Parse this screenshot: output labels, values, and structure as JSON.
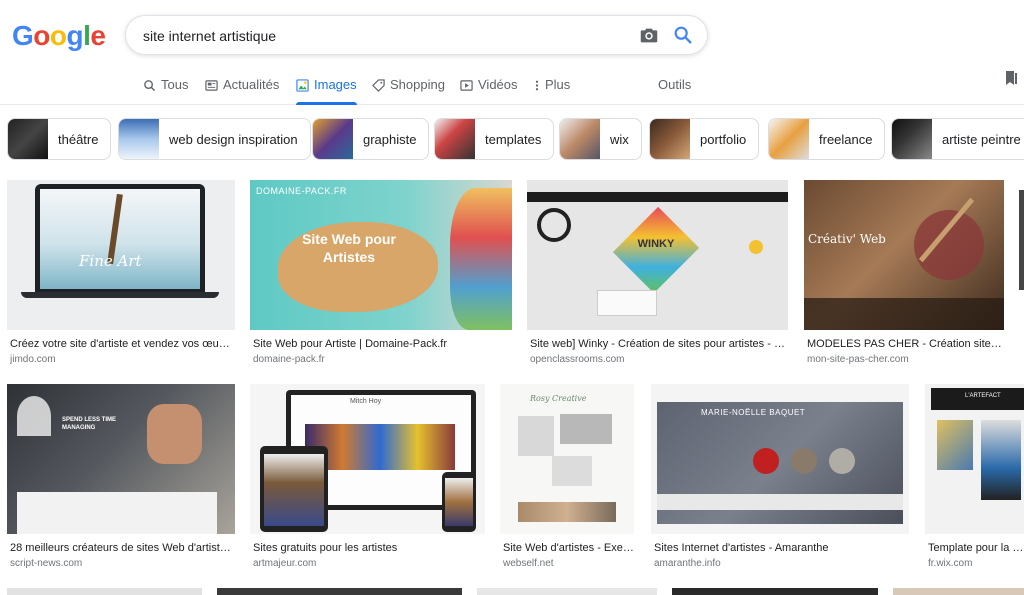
{
  "logo": {
    "letters": [
      "G",
      "o",
      "o",
      "g",
      "l",
      "e"
    ]
  },
  "search": {
    "query": "site internet artistique"
  },
  "tabs": [
    {
      "label": "Tous",
      "icon": "search-icon"
    },
    {
      "label": "Actualités",
      "icon": "newspaper-icon"
    },
    {
      "label": "Images",
      "icon": "image-icon",
      "active": true
    },
    {
      "label": "Shopping",
      "icon": "tag-icon"
    },
    {
      "label": "Vidéos",
      "icon": "play-icon"
    },
    {
      "label": "Plus",
      "icon": "more-vert-icon"
    }
  ],
  "tools_label": "Outils",
  "chips": [
    "théâtre",
    "web design inspiration",
    "graphiste",
    "templates",
    "wix",
    "portfolio",
    "freelance",
    "artiste peintre"
  ],
  "results": [
    {
      "title": "Créez votre site d'artiste et vendez vos œuvre…",
      "domain": "jimdo.com",
      "thumb_text": "Fine Art"
    },
    {
      "title": "Site Web pour Artiste | Domaine-Pack.fr",
      "domain": "domaine-pack.fr",
      "thumb_text": "Site Web pour Artistes",
      "thumb_brand": "DOMAINE-PACK.FR"
    },
    {
      "title": "Site web] Winky - Création de sites pour artistes - Cré…",
      "domain": "openclassrooms.com",
      "thumb_text": "WINKY"
    },
    {
      "title": "MODELES PAS CHER - Création site inte…",
      "domain": "mon-site-pas-cher.com",
      "thumb_text": "Créativ' Web"
    },
    {
      "title": "28 meilleurs créateurs de sites Web d'artistes…",
      "domain": "script-news.com",
      "thumb_text": "SPEND LESS TIME MANAGING"
    },
    {
      "title": "Sites gratuits pour les artistes",
      "domain": "artmajeur.com",
      "thumb_text": "Mitch Hoy"
    },
    {
      "title": "Site Web d'artistes - Exem…",
      "domain": "webself.net",
      "thumb_text": "Rosy Creative"
    },
    {
      "title": "Sites Internet d'artistes - Amaranthe",
      "domain": "amaranthe.info",
      "thumb_text": "MARIE-NOËLLE BAQUET"
    },
    {
      "title": "Template pour la cat…",
      "domain": "fr.wix.com",
      "thumb_text": "L'ARTEFACT"
    }
  ],
  "colors": {
    "blue": "#4285f4",
    "red": "#ea4335",
    "yellow": "#fbbc05",
    "green": "#34a853",
    "accent": "#1a73e8"
  }
}
